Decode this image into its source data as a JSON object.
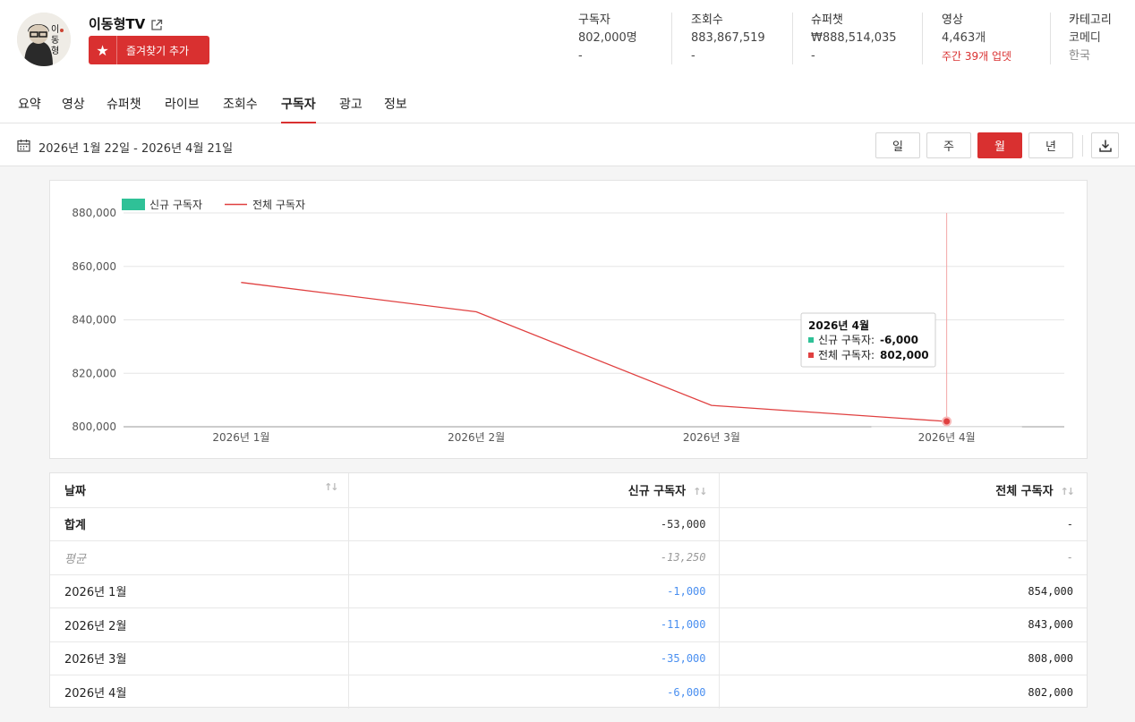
{
  "channel": {
    "name": "이동형TV",
    "favorite_label": "즐겨찾기 추가",
    "avatar_text": "이동형"
  },
  "stats": [
    {
      "label": "구독자",
      "value": "802,000명",
      "sub": "-"
    },
    {
      "label": "조회수",
      "value": "883,867,519",
      "sub": "-"
    },
    {
      "label": "슈퍼챗",
      "value": "₩888,514,035",
      "sub": "-"
    },
    {
      "label": "영상",
      "value": "4,463개",
      "sub": "주간  39개  업뎃"
    },
    {
      "label": "카테고리",
      "value": "코메디",
      "sub": "한국"
    }
  ],
  "tabs": [
    "요약",
    "영상",
    "슈퍼챗",
    "라이브",
    "조회수",
    "구독자",
    "광고",
    "정보"
  ],
  "active_tab": "구독자",
  "date_range": "2026년 1월 22일 - 2026년 4월 21일",
  "periods": [
    "일",
    "주",
    "월",
    "년"
  ],
  "active_period": "월",
  "colors": {
    "accent": "#d93030",
    "new_subs": "#2fc197",
    "total_subs": "#e04040",
    "negative": "#4a8ff0"
  },
  "chart_data": {
    "type": "line",
    "categories": [
      "2026년 1월",
      "2026년 2월",
      "2026년 3월",
      "2026년 4월"
    ],
    "series": [
      {
        "name": "신규 구독자",
        "kind": "bar",
        "values": [
          -1000,
          -11000,
          -35000,
          -6000
        ]
      },
      {
        "name": "전체 구독자",
        "kind": "line",
        "values": [
          854000,
          843000,
          808000,
          802000
        ]
      }
    ],
    "ylim": [
      800000,
      880000
    ],
    "yticks": [
      "880,000",
      "860,000",
      "840,000",
      "820,000",
      "800,000"
    ],
    "ytick_values": [
      880000,
      860000,
      840000,
      820000,
      800000
    ],
    "grid": true,
    "legend": "top-left",
    "tooltip": {
      "title": "2026년 4월",
      "new_label": "신규 구독자:",
      "new_value": "-6,000",
      "total_label": "전체 구독자:",
      "total_value": "802,000"
    }
  },
  "table": {
    "headers": [
      "날짜",
      "신규 구독자",
      "전체 구독자"
    ],
    "total": {
      "label": "합계",
      "new": "-53,000",
      "total": "-"
    },
    "average": {
      "label": "평균",
      "new": "-13,250",
      "total": "-"
    },
    "rows": [
      {
        "date": "2026년 1월",
        "new": "-1,000",
        "total": "854,000"
      },
      {
        "date": "2026년 2월",
        "new": "-11,000",
        "total": "843,000"
      },
      {
        "date": "2026년 3월",
        "new": "-35,000",
        "total": "808,000"
      },
      {
        "date": "2026년 4월",
        "new": "-6,000",
        "total": "802,000"
      }
    ]
  }
}
